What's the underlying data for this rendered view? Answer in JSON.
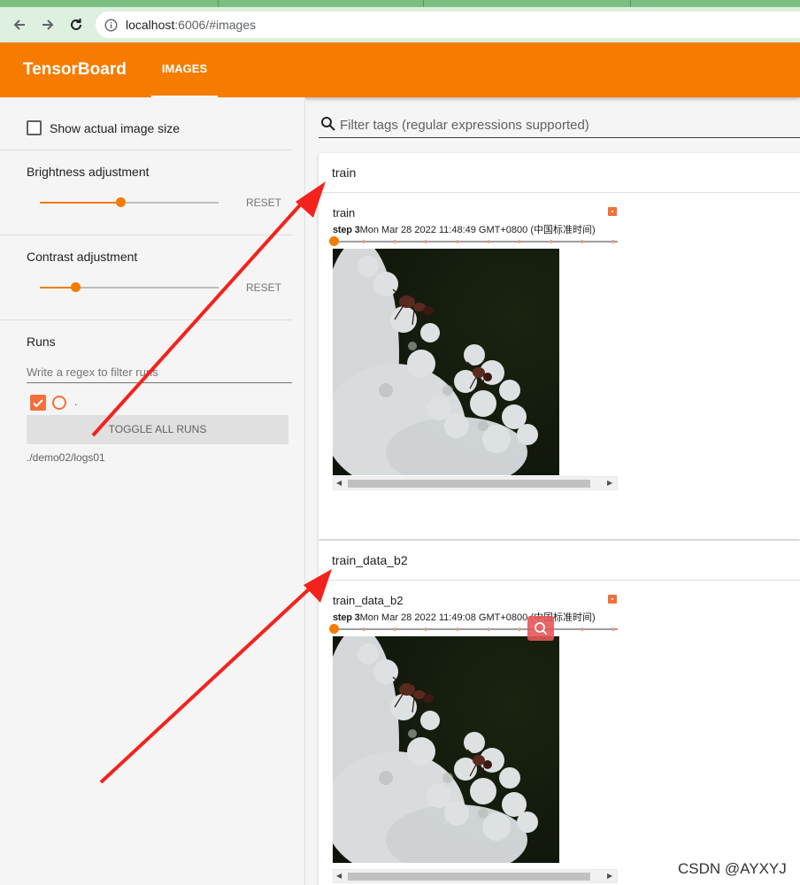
{
  "browser": {
    "url_host": "localhost",
    "url_path": ":6006/#images"
  },
  "header": {
    "brand": "TensorBoard",
    "tab_images": "IMAGES"
  },
  "sidebar": {
    "show_actual_size_label": "Show actual image size",
    "show_actual_size_checked": false,
    "brightness_label": "Brightness adjustment",
    "brightness_level": 0.45,
    "contrast_label": "Contrast adjustment",
    "contrast_level": 0.2,
    "reset_label": "RESET",
    "runs_heading": "Runs",
    "runs_filter_placeholder": "Write a regex to filter runs",
    "run_name": ".",
    "run_checked": true,
    "toggle_all_label": "TOGGLE ALL RUNS",
    "logdir": "./demo02/logs01"
  },
  "main": {
    "filter_placeholder": "Filter tags (regular expressions supported)",
    "cards": [
      {
        "title": "train",
        "tag": "train",
        "step_label": "step 3",
        "timestamp": "Mon Mar 28 2022 11:48:49 GMT+0800 (中国标准时间)"
      },
      {
        "title": "train_data_b2",
        "tag": "train_data_b2",
        "step_label": "step 3",
        "timestamp": "Mon Mar 28 2022 11:49:08 GMT+0800 (中国标准时间)"
      }
    ]
  },
  "watermark": "CSDN @AYXYJ",
  "colors": {
    "accent": "#f57c00",
    "run_color": "#f3703a",
    "annotation_arrow": "#f2231c"
  }
}
